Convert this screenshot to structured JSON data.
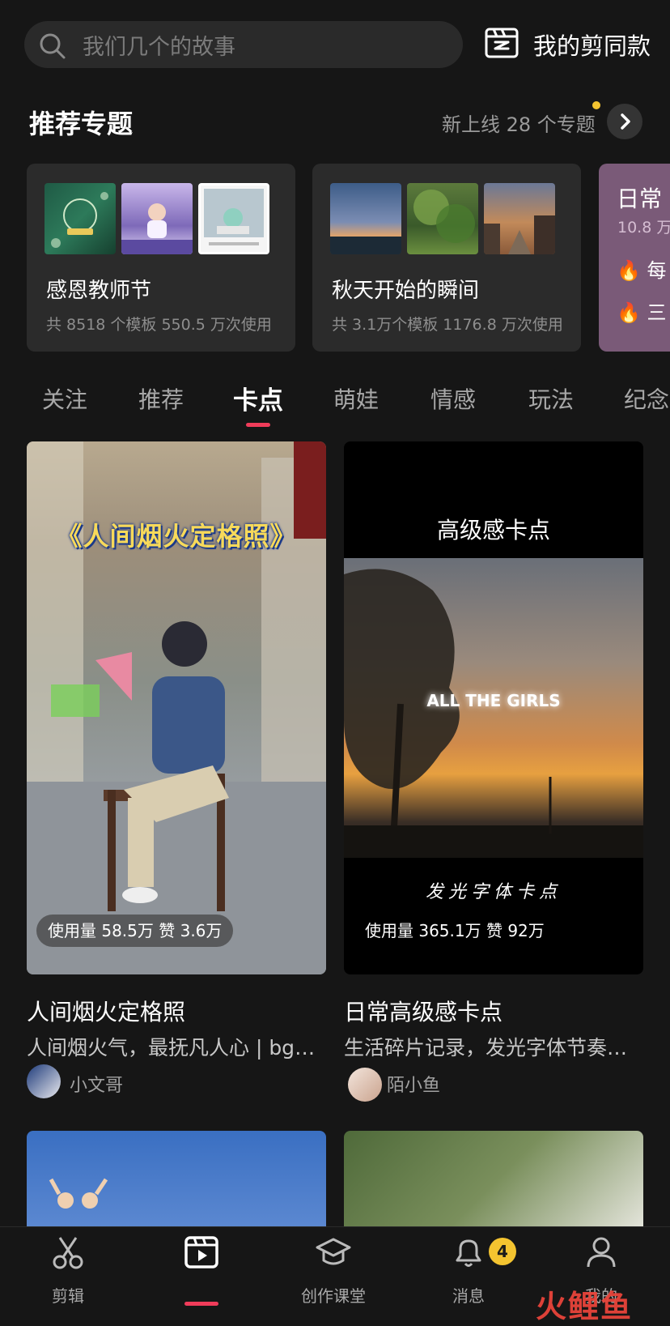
{
  "search": {
    "placeholder": "我们几个的故事"
  },
  "my_templates": {
    "label": "我的剪同款"
  },
  "topics": {
    "title": "推荐专题",
    "more": "新上线 28 个专题",
    "cards": [
      {
        "name": "感恩教师节",
        "stats": "共 8518 个模板 550.5 万次使用"
      },
      {
        "name": "秋天开始的瞬间",
        "stats": "共 3.1万个模板 1176.8 万次使用"
      },
      {
        "name": "日常",
        "stats": "10.8 万",
        "rows": [
          "每",
          "三"
        ]
      }
    ]
  },
  "tabs": [
    "关注",
    "推荐",
    "卡点",
    "萌娃",
    "情感",
    "玩法",
    "纪念"
  ],
  "active_tab_index": 2,
  "feed": [
    {
      "overlay_title": "《人间烟火定格照》",
      "stats": "使用量 58.5万 赞 3.6万",
      "title": "人间烟火定格照",
      "desc": "人间烟火气，最抚凡人心 | bgm...",
      "author": "小文哥"
    },
    {
      "header_text": "高级感卡点",
      "overlay_text": "ALL THE GIRLS",
      "footer_text": "发光字体卡点",
      "stats": "使用量 365.1万 赞 92万",
      "title": "日常高级感卡点",
      "desc": "生活碎片记录，发光字体节奏感...",
      "author": "陌小鱼"
    }
  ],
  "bottom_nav": {
    "items": [
      {
        "label": "剪辑",
        "icon": "scissors-icon"
      },
      {
        "label": "",
        "icon": "template-play-icon"
      },
      {
        "label": "创作课堂",
        "icon": "graduation-cap-icon"
      },
      {
        "label": "消息",
        "icon": "bell-icon"
      },
      {
        "label": "我的",
        "icon": "person-icon"
      }
    ],
    "badge": "4"
  },
  "watermark": "火鲤鱼",
  "colors": {
    "accent": "#f03c5a",
    "badge": "#f4c430",
    "background": "#161616"
  }
}
